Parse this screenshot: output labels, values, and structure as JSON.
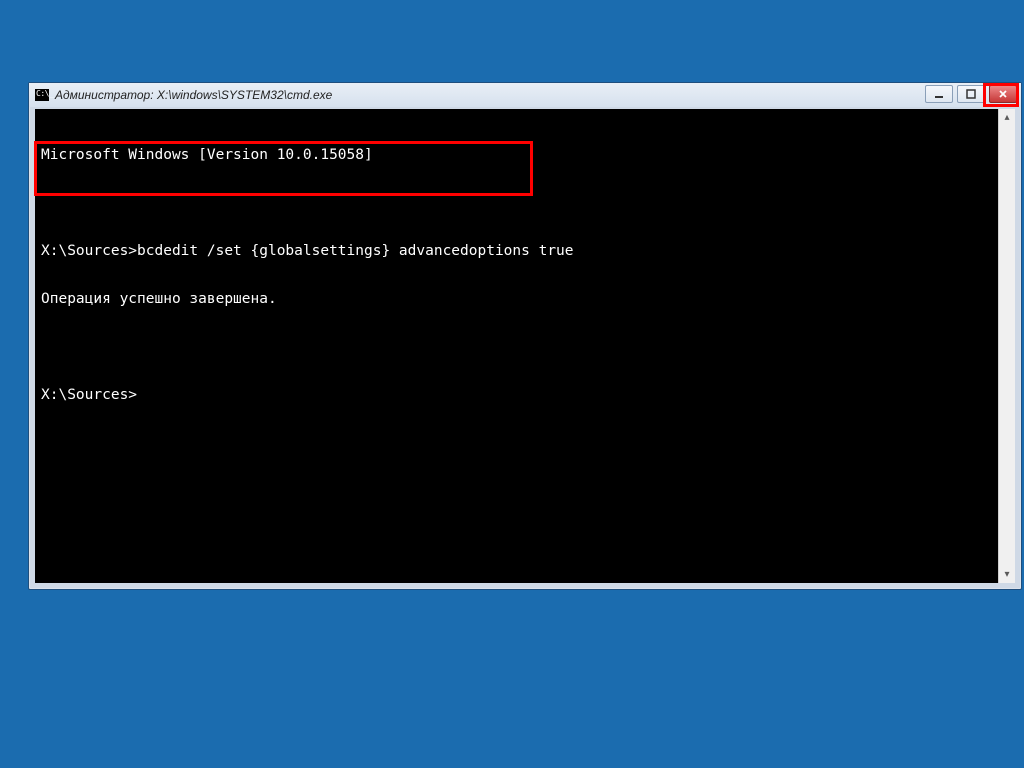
{
  "window": {
    "title": "Администратор: X:\\windows\\SYSTEM32\\cmd.exe"
  },
  "terminal": {
    "lines": [
      "Microsoft Windows [Version 10.0.15058]",
      "",
      "X:\\Sources>bcdedit /set {globalsettings} advancedoptions true",
      "Операция успешно завершена.",
      "",
      "X:\\Sources>"
    ]
  },
  "controls": {
    "minimize": "minimize",
    "maximize": "maximize",
    "close": "close"
  }
}
